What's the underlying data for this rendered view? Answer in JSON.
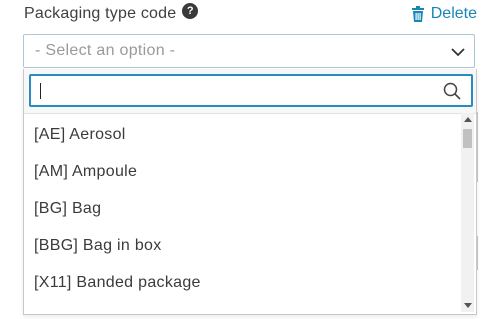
{
  "field": {
    "label": "Packaging type code",
    "help_icon": "question-icon",
    "delete_label": "Delete",
    "delete_icon": "trash-icon",
    "placeholder": "- Select an option -"
  },
  "dropdown": {
    "search_value": "",
    "options": [
      {
        "label": "[AE] Aerosol"
      },
      {
        "label": "[AM] Ampoule"
      },
      {
        "label": "[BG] Bag"
      },
      {
        "label": "[BBG] Bag in box"
      },
      {
        "label": "[X11] Banded package"
      }
    ]
  },
  "colors": {
    "accent": "#1a86b5",
    "focus_border": "#2a8bc0"
  }
}
